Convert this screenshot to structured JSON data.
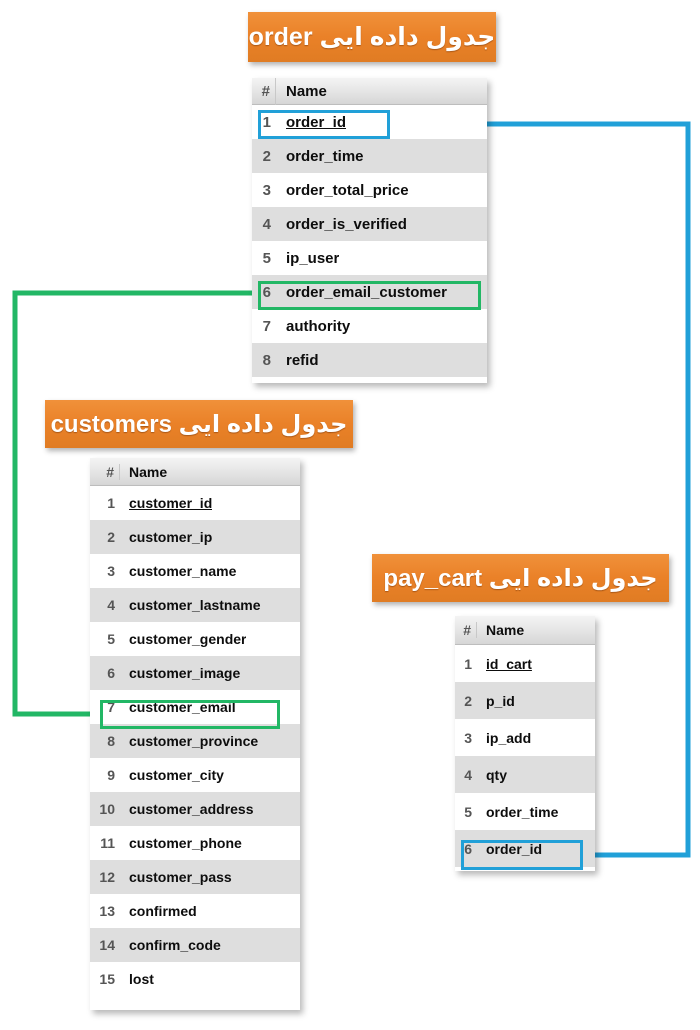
{
  "diagram": {
    "title": "Database tables relationship diagram",
    "colors": {
      "banner_orange": "#ea8128",
      "highlight_blue": "#21a0d8",
      "highlight_green": "#22b765",
      "row_odd": "#ffffff",
      "row_even": "#dedede",
      "header_gray": "#e4e4e4"
    }
  },
  "tables": [
    {
      "key": "order",
      "banner_label": "جدول داده ایی order",
      "columns_header": {
        "num": "#",
        "name": "Name"
      },
      "rows": [
        {
          "num": "1",
          "name": "order_id",
          "pk": true,
          "highlight": "blue"
        },
        {
          "num": "2",
          "name": "order_time",
          "pk": false,
          "highlight": ""
        },
        {
          "num": "3",
          "name": "order_total_price",
          "pk": false,
          "highlight": ""
        },
        {
          "num": "4",
          "name": "order_is_verified",
          "pk": false,
          "highlight": ""
        },
        {
          "num": "5",
          "name": "ip_user",
          "pk": false,
          "highlight": ""
        },
        {
          "num": "6",
          "name": "order_email_customer",
          "pk": false,
          "highlight": "green"
        },
        {
          "num": "7",
          "name": "authority",
          "pk": false,
          "highlight": ""
        },
        {
          "num": "8",
          "name": "refid",
          "pk": false,
          "highlight": ""
        }
      ]
    },
    {
      "key": "customers",
      "banner_label": "جدول داده ایی customers",
      "columns_header": {
        "num": "#",
        "name": "Name"
      },
      "rows": [
        {
          "num": "1",
          "name": "customer_id",
          "pk": true,
          "highlight": ""
        },
        {
          "num": "2",
          "name": "customer_ip",
          "pk": false,
          "highlight": ""
        },
        {
          "num": "3",
          "name": "customer_name",
          "pk": false,
          "highlight": ""
        },
        {
          "num": "4",
          "name": "customer_lastname",
          "pk": false,
          "highlight": ""
        },
        {
          "num": "5",
          "name": "customer_gender",
          "pk": false,
          "highlight": ""
        },
        {
          "num": "6",
          "name": "customer_image",
          "pk": false,
          "highlight": ""
        },
        {
          "num": "7",
          "name": "customer_email",
          "pk": false,
          "highlight": "green"
        },
        {
          "num": "8",
          "name": "customer_province",
          "pk": false,
          "highlight": ""
        },
        {
          "num": "9",
          "name": "customer_city",
          "pk": false,
          "highlight": ""
        },
        {
          "num": "10",
          "name": "customer_address",
          "pk": false,
          "highlight": ""
        },
        {
          "num": "11",
          "name": "customer_phone",
          "pk": false,
          "highlight": ""
        },
        {
          "num": "12",
          "name": "customer_pass",
          "pk": false,
          "highlight": ""
        },
        {
          "num": "13",
          "name": "confirmed",
          "pk": false,
          "highlight": ""
        },
        {
          "num": "14",
          "name": "confirm_code",
          "pk": false,
          "highlight": ""
        },
        {
          "num": "15",
          "name": "lost",
          "pk": false,
          "highlight": ""
        }
      ]
    },
    {
      "key": "pay_cart",
      "banner_label": "جدول داده ایی pay_cart",
      "columns_header": {
        "num": "#",
        "name": "Name"
      },
      "rows": [
        {
          "num": "1",
          "name": "id_cart",
          "pk": true,
          "highlight": ""
        },
        {
          "num": "2",
          "name": "p_id",
          "pk": false,
          "highlight": ""
        },
        {
          "num": "3",
          "name": "ip_add",
          "pk": false,
          "highlight": ""
        },
        {
          "num": "4",
          "name": "qty",
          "pk": false,
          "highlight": ""
        },
        {
          "num": "5",
          "name": "order_time",
          "pk": false,
          "highlight": ""
        },
        {
          "num": "6",
          "name": "order_id",
          "pk": false,
          "highlight": "blue"
        }
      ]
    }
  ],
  "relations": [
    {
      "key": "order-id-to-paycart-order-id",
      "color": "#21a0d8",
      "from_table": "order",
      "from_field": "order_id",
      "to_table": "pay_cart",
      "to_field": "order_id"
    },
    {
      "key": "order-email-customer-to-customer-email",
      "color": "#22b765",
      "from_table": "order",
      "from_field": "order_email_customer",
      "to_table": "customers",
      "to_field": "customer_email"
    }
  ]
}
